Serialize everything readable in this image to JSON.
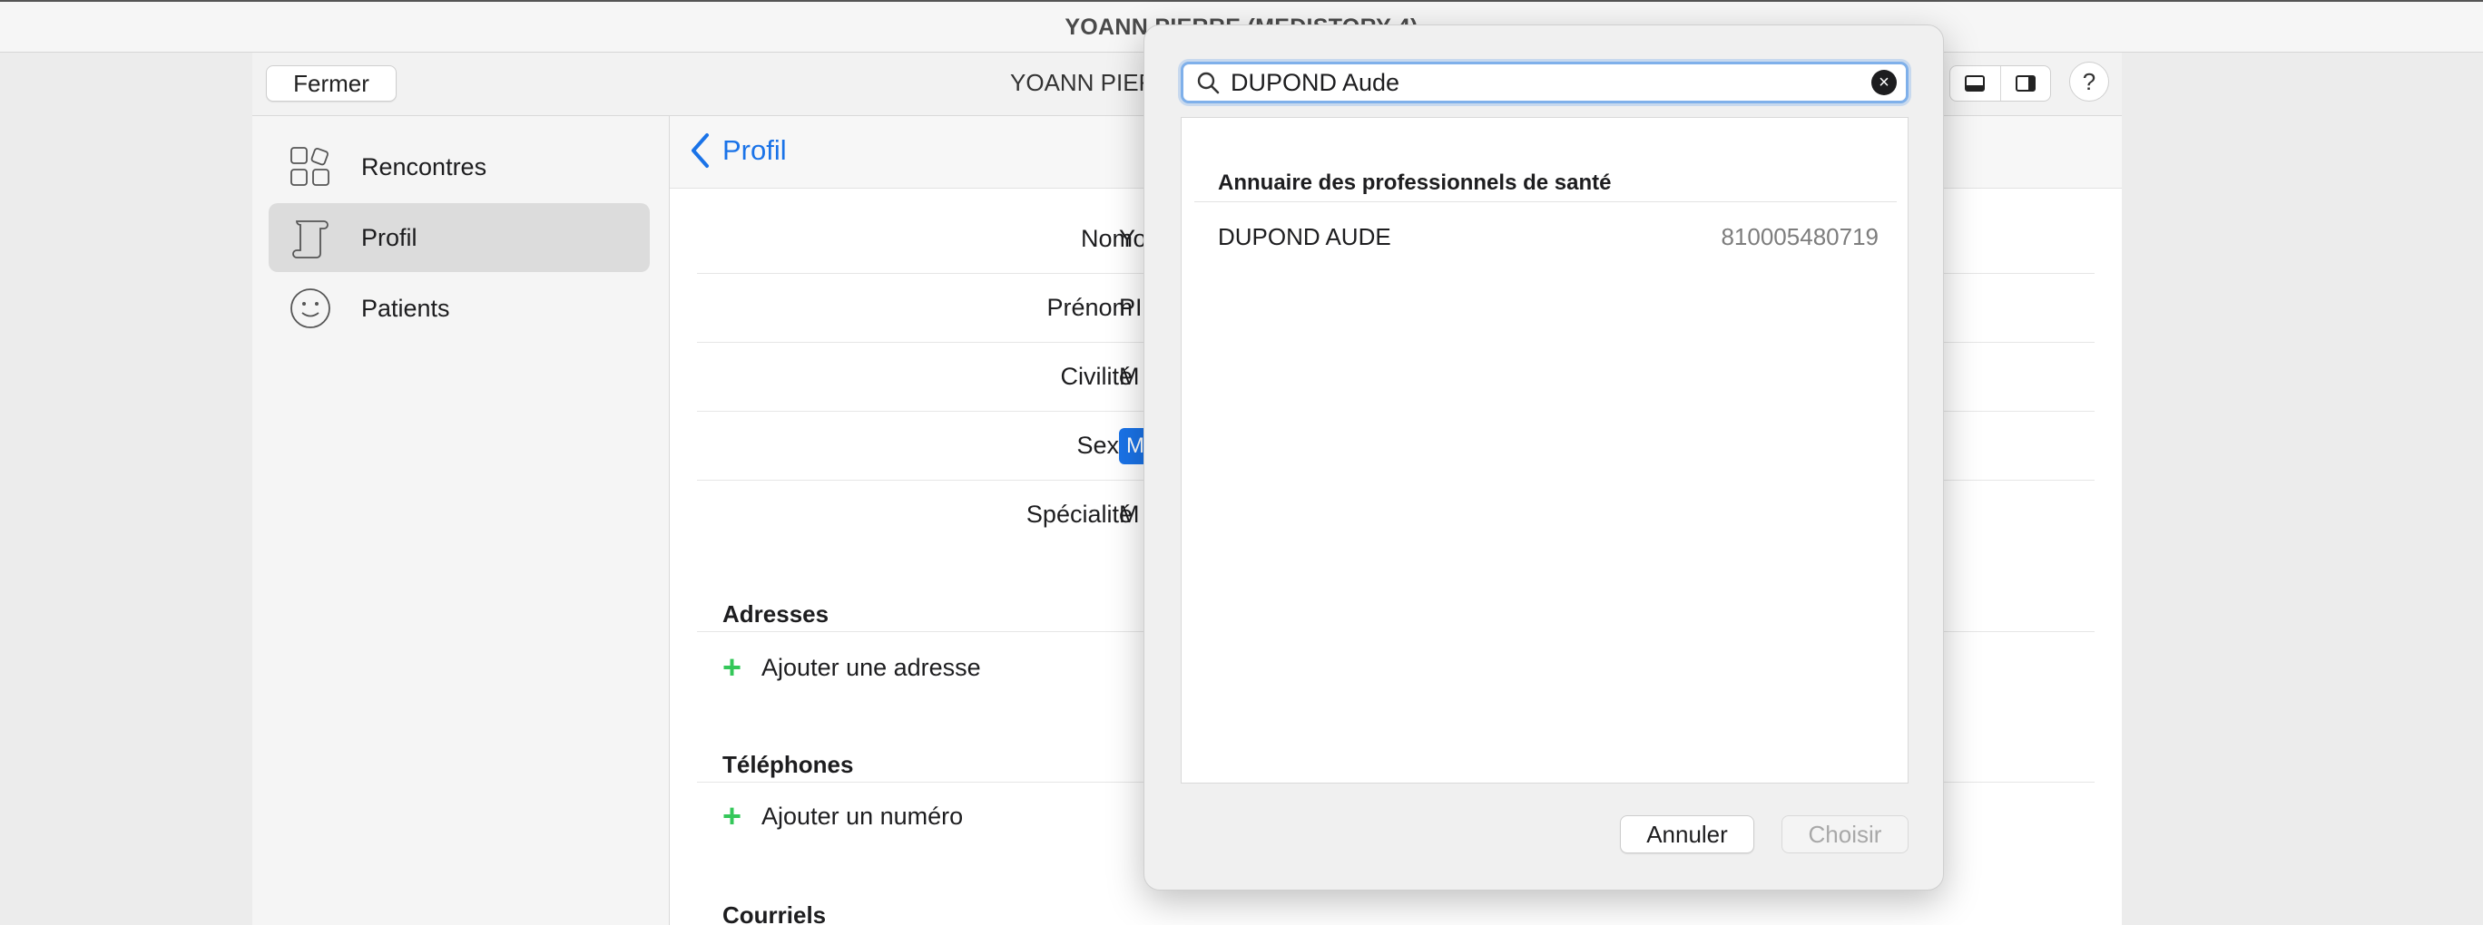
{
  "app": {
    "title": "YOANN PIERRE (MEDISTORY 4)"
  },
  "toolbar": {
    "close_label": "Fermer",
    "window_title": "YOANN PIERRE (MEDISTORY 4)",
    "help_label": "?"
  },
  "sidebar": {
    "items": [
      {
        "label": "Rencontres",
        "icon": "shapes-icon",
        "active": false
      },
      {
        "label": "Profil",
        "icon": "scroll-icon",
        "active": true
      },
      {
        "label": "Patients",
        "icon": "smiley-face-icon",
        "active": false
      }
    ]
  },
  "profile": {
    "back_label": "Profil",
    "fields": [
      {
        "label": "Nom",
        "value": "Yo"
      },
      {
        "label": "Prénom",
        "value": "PI"
      },
      {
        "label": "Civilité",
        "value": "M"
      },
      {
        "label": "Sexe",
        "value": "M"
      },
      {
        "label": "Spécialité",
        "value": "M"
      }
    ],
    "sections": {
      "addresses": {
        "title": "Adresses",
        "add_label": "Ajouter une adresse"
      },
      "phones": {
        "title": "Téléphones",
        "add_label": "Ajouter un numéro"
      },
      "emails": {
        "title": "Courriels"
      }
    }
  },
  "modal": {
    "search_value": "DUPOND Aude",
    "group_title": "Annuaire des professionnels de santé",
    "results": [
      {
        "name": "DUPOND AUDE",
        "id": "810005480719"
      }
    ],
    "cancel_label": "Annuler",
    "choose_label": "Choisir"
  },
  "colors": {
    "accent": "#1a73e8",
    "add_green": "#34c759",
    "highlight_red": "#e0141e"
  }
}
